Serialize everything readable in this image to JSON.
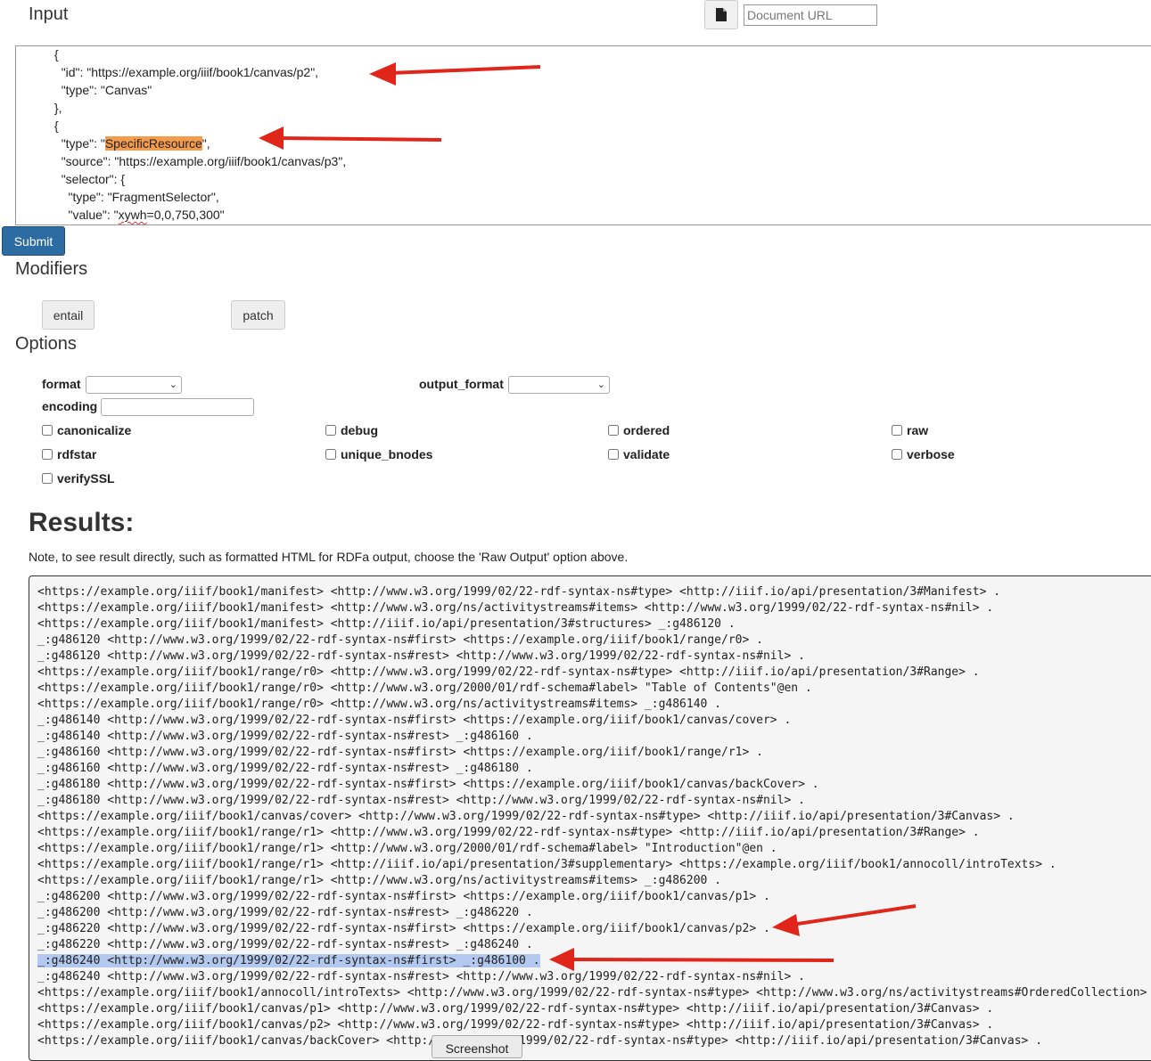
{
  "input": {
    "heading": "Input",
    "document_url_placeholder": "Document URL",
    "file_icon": "file-icon",
    "editor_lines": [
      {
        "indent": "          ",
        "text": "{"
      },
      {
        "indent": "            ",
        "pre": "\"id\": \"https://example.org/iiif/book1/canvas/p2\","
      },
      {
        "indent": "            ",
        "pre": "\"type\": \"Canvas\""
      },
      {
        "indent": "          ",
        "text": "},"
      },
      {
        "indent": "          ",
        "text": "{"
      },
      {
        "indent": "            ",
        "pre": "\"type\": \"",
        "highlight": "SpecificResource",
        "post": "\","
      },
      {
        "indent": "            ",
        "pre": "\"source\": \"https://example.org/iiif/book1/canvas/p3\","
      },
      {
        "indent": "            ",
        "pre": "\"selector\": {"
      },
      {
        "indent": "              ",
        "pre": "\"type\": \"FragmentSelector\","
      },
      {
        "indent": "              ",
        "pre": "\"value\": \"",
        "squiggle": "xywh",
        "post": "=0,0,750,300\""
      }
    ]
  },
  "submit_label": "Submit",
  "modifiers": {
    "heading": "Modifiers",
    "entail_label": "entail",
    "patch_label": "patch"
  },
  "options": {
    "heading": "Options",
    "format_label": "format",
    "output_format_label": "output_format",
    "encoding_label": "encoding",
    "checkboxes": [
      "canonicalize",
      "debug",
      "ordered",
      "raw",
      "rdfstar",
      "unique_bnodes",
      "validate",
      "verbose",
      "verifySSL"
    ]
  },
  "results": {
    "heading": "Results:",
    "note": "Note, to see result directly, such as formatted HTML for RDFa output, choose the 'Raw Output' option above.",
    "lines": [
      "<https://example.org/iiif/book1/manifest> <http://www.w3.org/1999/02/22-rdf-syntax-ns#type> <http://iiif.io/api/presentation/3#Manifest> .",
      "<https://example.org/iiif/book1/manifest> <http://www.w3.org/ns/activitystreams#items> <http://www.w3.org/1999/02/22-rdf-syntax-ns#nil> .",
      "<https://example.org/iiif/book1/manifest> <http://iiif.io/api/presentation/3#structures> _:g486120 .",
      "_:g486120 <http://www.w3.org/1999/02/22-rdf-syntax-ns#first> <https://example.org/iiif/book1/range/r0> .",
      "_:g486120 <http://www.w3.org/1999/02/22-rdf-syntax-ns#rest> <http://www.w3.org/1999/02/22-rdf-syntax-ns#nil> .",
      "<https://example.org/iiif/book1/range/r0> <http://www.w3.org/1999/02/22-rdf-syntax-ns#type> <http://iiif.io/api/presentation/3#Range> .",
      "<https://example.org/iiif/book1/range/r0> <http://www.w3.org/2000/01/rdf-schema#label> \"Table of Contents\"@en .",
      "<https://example.org/iiif/book1/range/r0> <http://www.w3.org/ns/activitystreams#items> _:g486140 .",
      "_:g486140 <http://www.w3.org/1999/02/22-rdf-syntax-ns#first> <https://example.org/iiif/book1/canvas/cover> .",
      "_:g486140 <http://www.w3.org/1999/02/22-rdf-syntax-ns#rest> _:g486160 .",
      "_:g486160 <http://www.w3.org/1999/02/22-rdf-syntax-ns#first> <https://example.org/iiif/book1/range/r1> .",
      "_:g486160 <http://www.w3.org/1999/02/22-rdf-syntax-ns#rest> _:g486180 .",
      "_:g486180 <http://www.w3.org/1999/02/22-rdf-syntax-ns#first> <https://example.org/iiif/book1/canvas/backCover> .",
      "_:g486180 <http://www.w3.org/1999/02/22-rdf-syntax-ns#rest> <http://www.w3.org/1999/02/22-rdf-syntax-ns#nil> .",
      "<https://example.org/iiif/book1/canvas/cover> <http://www.w3.org/1999/02/22-rdf-syntax-ns#type> <http://iiif.io/api/presentation/3#Canvas> .",
      "<https://example.org/iiif/book1/range/r1> <http://www.w3.org/1999/02/22-rdf-syntax-ns#type> <http://iiif.io/api/presentation/3#Range> .",
      "<https://example.org/iiif/book1/range/r1> <http://www.w3.org/2000/01/rdf-schema#label> \"Introduction\"@en .",
      "<https://example.org/iiif/book1/range/r1> <http://iiif.io/api/presentation/3#supplementary> <https://example.org/iiif/book1/annocoll/introTexts> .",
      "<https://example.org/iiif/book1/range/r1> <http://www.w3.org/ns/activitystreams#items> _:g486200 .",
      "_:g486200 <http://www.w3.org/1999/02/22-rdf-syntax-ns#first> <https://example.org/iiif/book1/canvas/p1> .",
      "_:g486200 <http://www.w3.org/1999/02/22-rdf-syntax-ns#rest> _:g486220 .",
      "_:g486220 <http://www.w3.org/1999/02/22-rdf-syntax-ns#first> <https://example.org/iiif/book1/canvas/p2> .",
      "_:g486220 <http://www.w3.org/1999/02/22-rdf-syntax-ns#rest> _:g486240 .",
      "_:g486240 <http://www.w3.org/1999/02/22-rdf-syntax-ns#first> _:g486100 .",
      "_:g486240 <http://www.w3.org/1999/02/22-rdf-syntax-ns#rest> <http://www.w3.org/1999/02/22-rdf-syntax-ns#nil> .",
      "<https://example.org/iiif/book1/annocoll/introTexts> <http://www.w3.org/1999/02/22-rdf-syntax-ns#type> <http://www.w3.org/ns/activitystreams#OrderedCollection> .",
      "<https://example.org/iiif/book1/canvas/p1> <http://www.w3.org/1999/02/22-rdf-syntax-ns#type> <http://iiif.io/api/presentation/3#Canvas> .",
      "<https://example.org/iiif/book1/canvas/p2> <http://www.w3.org/1999/02/22-rdf-syntax-ns#type> <http://iiif.io/api/presentation/3#Canvas> .",
      "<https://example.org/iiif/book1/canvas/backCover> <http://www.w3.org/1999/02/22-rdf-syntax-ns#type> <http://iiif.io/api/presentation/3#Canvas> ."
    ],
    "selected_line_index": 23
  },
  "screenshot_button_label": "Screenshot",
  "colors": {
    "submit_bg": "#2d6ca2",
    "highlight_orange": "#f59b4c",
    "selection_blue": "#b3c8ee",
    "arrow_red": "#e0261b"
  }
}
